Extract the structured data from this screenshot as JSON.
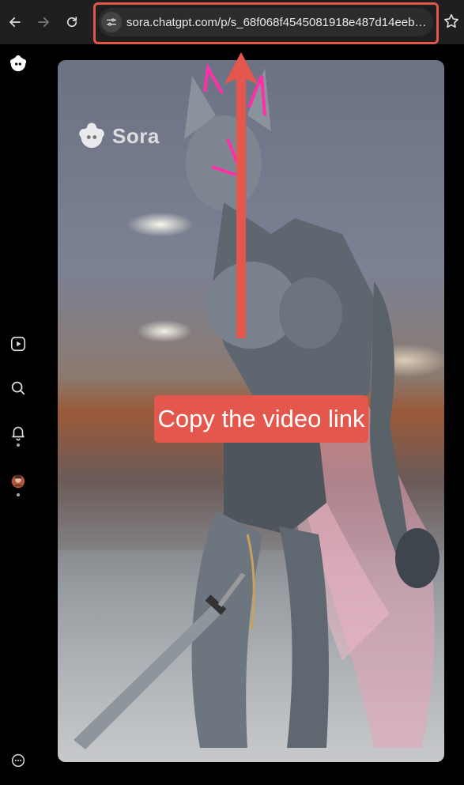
{
  "browser": {
    "url": "sora.chatgpt.com/p/s_68f068f4545081918e487d14eebc..."
  },
  "video": {
    "watermark_label": "Sora"
  },
  "annotation": {
    "callout_text": "Copy the video link",
    "highlight_color": "#e2564c"
  },
  "sidebar": {
    "items": [
      {
        "icon": "sora-logo-icon"
      },
      {
        "icon": "video-feed-icon"
      },
      {
        "icon": "search-icon"
      },
      {
        "icon": "bell-icon"
      },
      {
        "icon": "avatar"
      },
      {
        "icon": "more-icon"
      }
    ]
  },
  "colors": {
    "topbar": "#1f1f1f",
    "addressbar": "#2c2c2e",
    "accent_red": "#e4574d"
  }
}
